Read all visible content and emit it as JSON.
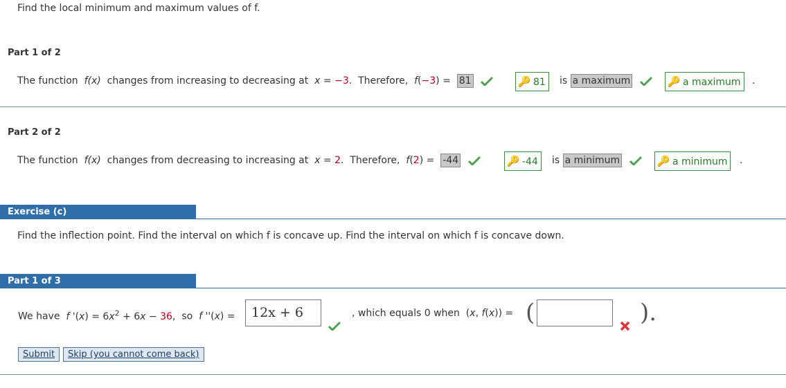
{
  "prompt_b": "Find the local minimum and maximum values of f.",
  "part1": {
    "label": "Part 1 of 2",
    "t1": "The function",
    "fx": "f(x)",
    "t2": "changes from increasing to decreasing at",
    "xeq": "x = −3.",
    "t3": "Therefore,",
    "fval": "f(−3) =",
    "boxed_answer": "81",
    "key_answer": "81",
    "is": "is",
    "boxed_type": "a maximum",
    "key_type": "a maximum",
    "period": "."
  },
  "part2": {
    "label": "Part 2 of 2",
    "t1": "The function",
    "fx": "f(x)",
    "t2": "changes from decreasing to increasing at",
    "xeq": "x = 2.",
    "t3": "Therefore,",
    "fval": "f(2) =",
    "boxed_answer": "-44",
    "key_answer": "-44",
    "is": "is",
    "boxed_type": "a minimum",
    "key_type": "a minimum",
    "period": "."
  },
  "exercise_c": {
    "title": "Exercise (c)",
    "prompt": "Find the inflection point. Find the interval on which f is concave up. Find the interval on which f is concave down.",
    "part1": {
      "label": "Part 1 of 3",
      "we_have": "We have",
      "fprime": "f '(x) = 6x",
      "exp": "2",
      "rest": "+ 6x − 36,",
      "so": "so",
      "fdouble": "f ''(x) =",
      "input_value": "12x + 6",
      "which": ", which equals 0 when",
      "point": "(x, f(x)) =",
      "point_value": "",
      "paren_open": "(",
      "paren_close": ")."
    },
    "buttons": {
      "submit": "Submit",
      "skip": "Skip (you cannot come back)"
    }
  },
  "colors": {
    "bar_blue": "#2f6ea8",
    "correct_green": "#4fa14f",
    "wrong_red": "#d9363e",
    "key_gold": "#d4a600"
  }
}
